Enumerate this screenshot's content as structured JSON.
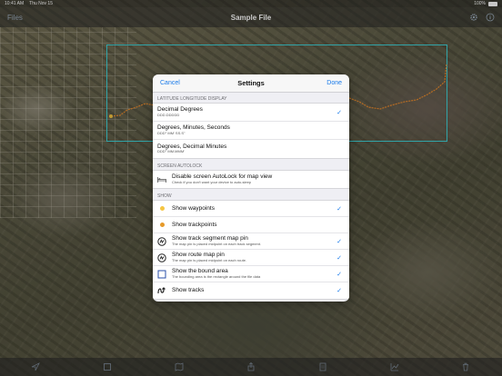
{
  "status_bar": {
    "time": "10:41 AM",
    "date": "Thu Nov 15",
    "battery": "100%"
  },
  "nav": {
    "back_label": "Files",
    "title": "Sample File",
    "settings_icon": "gear-icon",
    "info_icon": "info-icon"
  },
  "sheet": {
    "cancel_label": "Cancel",
    "title": "Settings",
    "done_label": "Done",
    "lat_section": "LATITUDE LONGITUDE DISPLAY",
    "lat_options": [
      {
        "main": "Decimal Degrees",
        "sub": "DDD.DDDDD",
        "checked": true
      },
      {
        "main": "Degrees, Minutes, Seconds",
        "sub": "DDD° MM' SS.S\"",
        "checked": false
      },
      {
        "main": "Degrees, Decimal Minutes",
        "sub": "DDD° MM.MMM'",
        "checked": false
      }
    ],
    "autolock_section": "SCREEN AUTOLOCK",
    "autolock": {
      "main": "Disable screen AutoLock for map view",
      "sub": "Check if you don't want your device to auto-sleep",
      "checked": false
    },
    "show_section": "SHOW",
    "show_items": [
      {
        "main": "Show waypoints",
        "sub": "",
        "checked": true
      },
      {
        "main": "Show trackpoints",
        "sub": "",
        "checked": false
      },
      {
        "main": "Show track segment map pin",
        "sub": "The map pin is placed midpoint on each track segment.",
        "checked": true
      },
      {
        "main": "Show route map pin",
        "sub": "The map pin is placed midpoint on each route.",
        "checked": true
      },
      {
        "main": "Show the bound area",
        "sub": "The bounding area is the rectangle around the file data",
        "checked": true
      },
      {
        "main": "Show tracks",
        "sub": "",
        "checked": true
      }
    ],
    "check_glyph": "✓"
  },
  "colors": {
    "accent": "#1a7bea",
    "waypoint_dot": "#f5c542",
    "trackpoint_dot": "#e69a2a",
    "bound_box": "#3fd2d8",
    "track_line": "#e88a2e"
  }
}
